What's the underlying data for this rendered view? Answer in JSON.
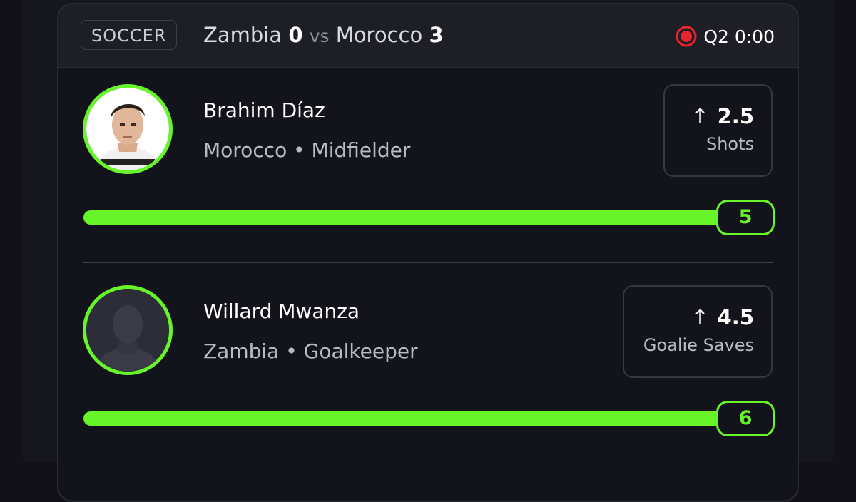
{
  "header": {
    "sport": "SOCCER",
    "team_a": "Zambia",
    "team_a_score": "0",
    "vs": "vs",
    "team_b": "Morocco",
    "team_b_score": "3",
    "live_status": "Q2 0:00",
    "live_icon": "live-record-icon",
    "live_color": "#e8242c"
  },
  "accent_color": "#67f52a",
  "players": [
    {
      "name": "Brahim Díaz",
      "meta": "Morocco • Midfielder",
      "line": "2.5",
      "stat": "Shots",
      "direction_icon": "arrow-up-icon",
      "current_value": "5",
      "progress_fraction": 1.0
    },
    {
      "name": "Willard Mwanza",
      "meta": "Zambia • Goalkeeper",
      "line": "4.5",
      "stat": "Goalie Saves",
      "direction_icon": "arrow-up-icon",
      "current_value": "6",
      "progress_fraction": 1.0
    }
  ]
}
